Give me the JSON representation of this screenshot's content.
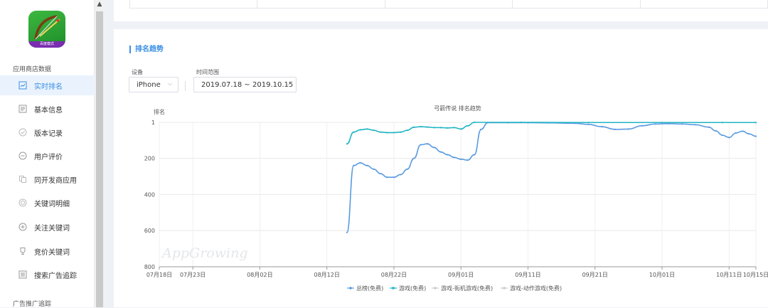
{
  "sidebar": {
    "section1": "应用商店数据",
    "items": [
      {
        "label": "实时排名",
        "icon": "chart-box-icon"
      },
      {
        "label": "基本信息",
        "icon": "document-icon"
      },
      {
        "label": "版本记录",
        "icon": "check-circle-icon"
      },
      {
        "label": "用户评价",
        "icon": "comment-circle-icon"
      },
      {
        "label": "同开发商应用",
        "icon": "copy-icon"
      },
      {
        "label": "关键词明细",
        "icon": "target-icon"
      },
      {
        "label": "关注关键词",
        "icon": "plus-circle-icon"
      },
      {
        "label": "竞价关键词",
        "icon": "trophy-icon"
      },
      {
        "label": "搜索广告追踪",
        "icon": "list-icon"
      }
    ],
    "section2": "广告推广追踪",
    "app_badge": "百度模式",
    "active_color": "#3b8ee3"
  },
  "main": {
    "section_title": "排名趋势",
    "device_label": "设备",
    "device_value": "iPhone",
    "range_label": "时间范围",
    "range_value": "2019.07.18 ~ 2019.10.15"
  },
  "chart_data": {
    "type": "line",
    "title": "弓箭传说 排名趋势",
    "ylabel": "排名",
    "ylim": [
      1,
      800
    ],
    "y_inverted": true,
    "yticks": [
      1,
      200,
      400,
      600,
      800
    ],
    "xlim": [
      "07-18",
      "10-15"
    ],
    "xticks": [
      "07月18日",
      "07月23日",
      "08月02日",
      "08月12日",
      "08月22日",
      "09月01日",
      "09月11日",
      "09月21日",
      "10月01日",
      "10月11日",
      "10月15日"
    ],
    "watermark": "AppGrowing",
    "legend": {
      "placement": "bottom"
    },
    "series": [
      {
        "name": "总榜(免费)",
        "color": "#5a9be0",
        "visible": true,
        "points": [
          [
            "08-15",
            610
          ],
          [
            "08-16",
            240
          ],
          [
            "08-17",
            225
          ],
          [
            "08-18",
            240
          ],
          [
            "08-19",
            260
          ],
          [
            "08-20",
            285
          ],
          [
            "08-21",
            305
          ],
          [
            "08-22",
            305
          ],
          [
            "08-23",
            290
          ],
          [
            "08-24",
            260
          ],
          [
            "08-25",
            200
          ],
          [
            "08-26",
            125
          ],
          [
            "08-27",
            120
          ],
          [
            "08-28",
            140
          ],
          [
            "08-29",
            165
          ],
          [
            "08-30",
            180
          ],
          [
            "08-31",
            195
          ],
          [
            "09-01",
            205
          ],
          [
            "09-02",
            210
          ],
          [
            "09-03",
            180
          ],
          [
            "09-04",
            40
          ],
          [
            "09-05",
            3
          ],
          [
            "09-08",
            3
          ],
          [
            "09-11",
            3
          ],
          [
            "09-14",
            4
          ],
          [
            "09-18",
            6
          ],
          [
            "09-20",
            12
          ],
          [
            "09-22",
            25
          ],
          [
            "09-24",
            40
          ],
          [
            "09-26",
            38
          ],
          [
            "09-28",
            20
          ],
          [
            "09-30",
            10
          ],
          [
            "10-02",
            8
          ],
          [
            "10-04",
            10
          ],
          [
            "10-06",
            14
          ],
          [
            "10-08",
            28
          ],
          [
            "10-09",
            48
          ],
          [
            "10-10",
            72
          ],
          [
            "10-11",
            85
          ],
          [
            "10-12",
            60
          ],
          [
            "10-13",
            50
          ],
          [
            "10-14",
            65
          ],
          [
            "10-15",
            78
          ]
        ]
      },
      {
        "name": "游戏(免费)",
        "color": "#1fb5c4",
        "visible": true,
        "points": [
          [
            "08-15",
            120
          ],
          [
            "08-16",
            55
          ],
          [
            "08-17",
            42
          ],
          [
            "08-18",
            38
          ],
          [
            "08-19",
            45
          ],
          [
            "08-20",
            55
          ],
          [
            "08-21",
            58
          ],
          [
            "08-22",
            58
          ],
          [
            "08-23",
            55
          ],
          [
            "08-24",
            45
          ],
          [
            "08-25",
            28
          ],
          [
            "08-26",
            25
          ],
          [
            "08-27",
            27
          ],
          [
            "08-28",
            30
          ],
          [
            "08-29",
            30
          ],
          [
            "08-30",
            32
          ],
          [
            "08-31",
            30
          ],
          [
            "09-01",
            38
          ],
          [
            "09-02",
            20
          ],
          [
            "09-03",
            1
          ],
          [
            "09-10",
            1
          ],
          [
            "09-20",
            2
          ],
          [
            "10-01",
            2
          ],
          [
            "10-10",
            2
          ],
          [
            "10-15",
            2
          ]
        ]
      },
      {
        "name": "游戏-街机游戏(免费)",
        "color": "#c0c4cc",
        "visible": false,
        "points": []
      },
      {
        "name": "游戏-动作游戏(免费)",
        "color": "#c0c4cc",
        "visible": false,
        "points": []
      }
    ]
  }
}
